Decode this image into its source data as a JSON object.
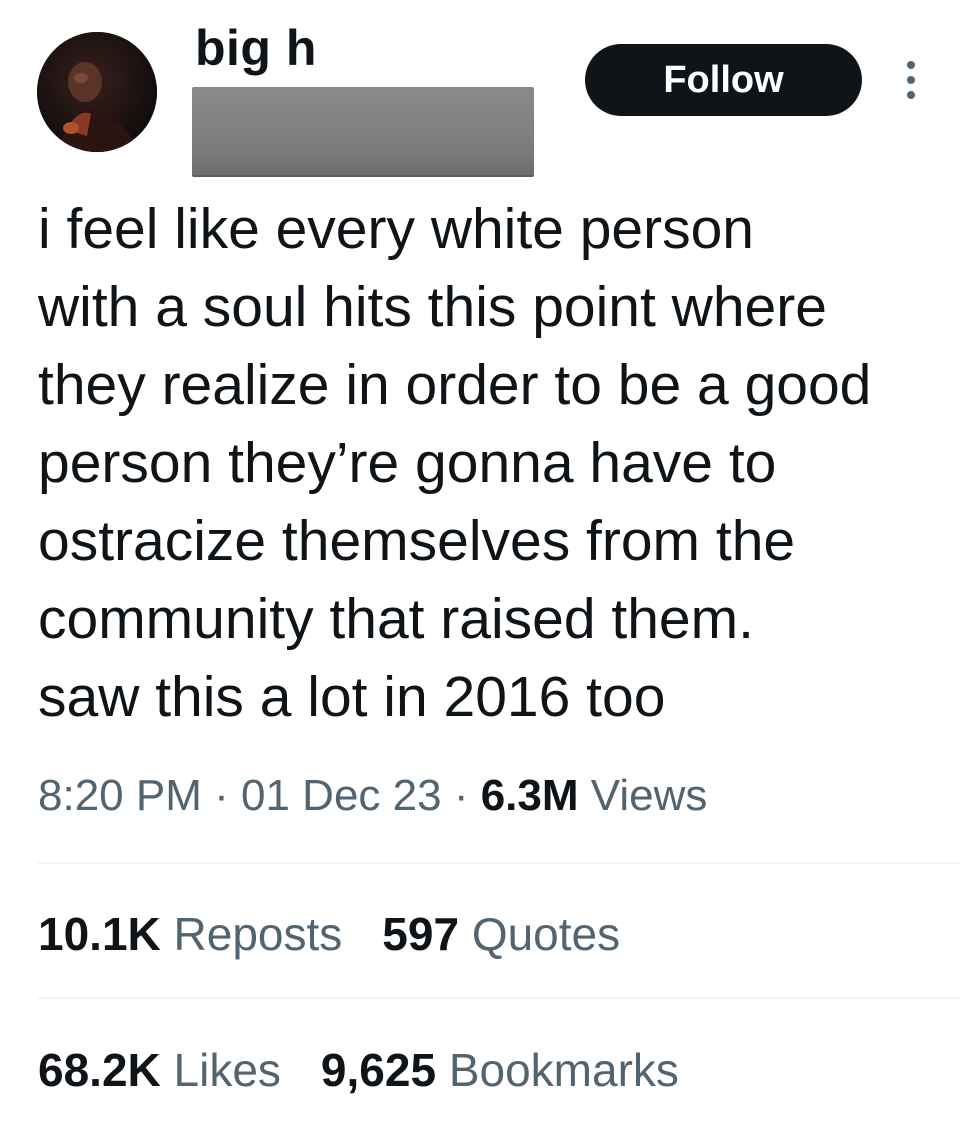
{
  "author": {
    "display_name": "big h",
    "avatar": "profile-photo"
  },
  "actions": {
    "follow_label": "Follow",
    "more_icon": "more-vertical-icon"
  },
  "tweet": {
    "lines": [
      "i feel like every white person",
      "with a soul hits this point where",
      "they realize in order to be a good",
      "person they’re gonna have to",
      "ostracize themselves from the",
      "community that raised them.",
      "saw this a lot in 2016 too"
    ]
  },
  "meta": {
    "time": "8:20 PM",
    "separator": "·",
    "date": "01 Dec 23",
    "views_count": "6.3M",
    "views_label": "Views"
  },
  "stats": {
    "reposts": {
      "count": "10.1K",
      "label": "Reposts"
    },
    "quotes": {
      "count": "597",
      "label": "Quotes"
    },
    "likes": {
      "count": "68.2K",
      "label": "Likes"
    },
    "bookmarks": {
      "count": "9,625",
      "label": "Bookmarks"
    }
  },
  "colors": {
    "text_primary": "#0f1419",
    "text_secondary": "#536471",
    "button_bg": "#0f1419",
    "divider": "#eff3f4",
    "redaction": "#7c7c7c"
  }
}
